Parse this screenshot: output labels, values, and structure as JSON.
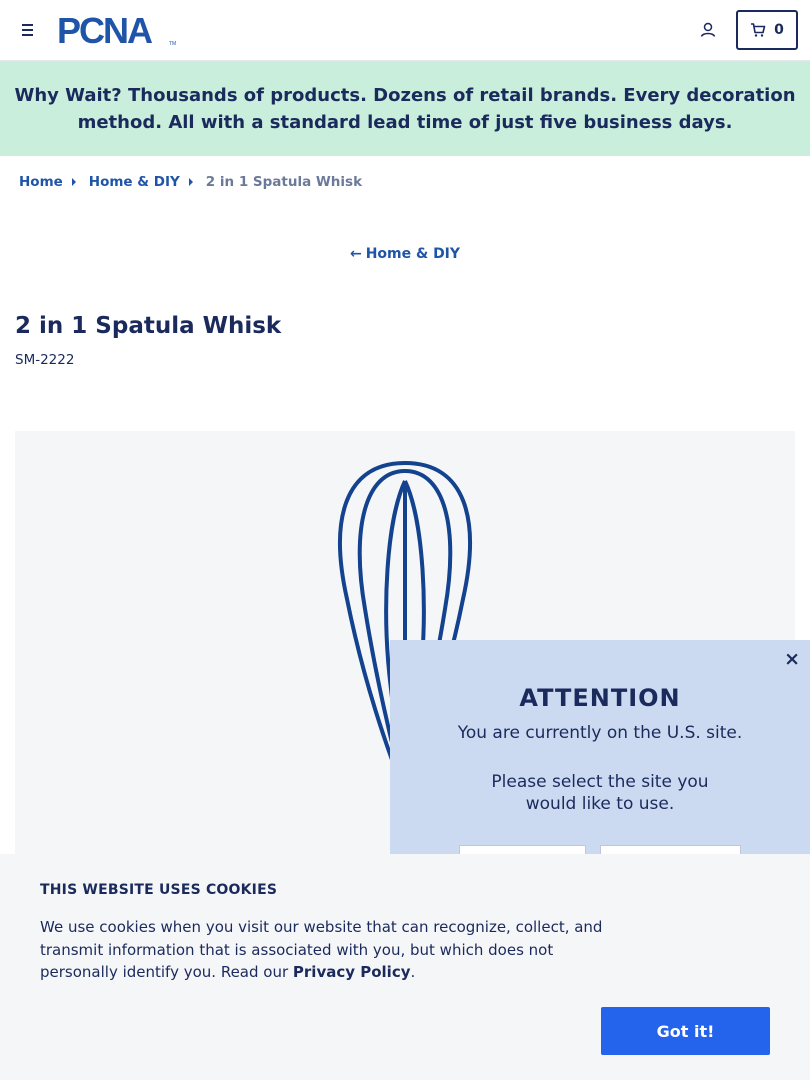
{
  "header": {
    "logo_text": "PCNA",
    "logo_trademark": "TM",
    "cart_count": "0",
    "icons": {
      "menu": "hamburger-menu-icon",
      "account": "user-account-icon",
      "cart": "shopping-cart-icon"
    }
  },
  "promo": {
    "lead": "Why Wait?",
    "text": " Thousands of products. Dozens of retail brands. Every decoration method. All with a standard lead time of just five business days."
  },
  "breadcrumb": {
    "items": [
      "Home",
      "Home & DIY"
    ],
    "current": "2 in 1 Spatula Whisk"
  },
  "back_link": {
    "arrow": "←",
    "label": "Home & DIY"
  },
  "product": {
    "title": "2 in 1 Spatula Whisk",
    "sku": "SM-2222"
  },
  "region_modal": {
    "close": "×",
    "title": "ATTENTION",
    "message": "You are currently on the U.S. site.",
    "prompt": "Please select the site you would like to use."
  },
  "cookie_banner": {
    "title": "THIS WEBSITE USES COOKIES",
    "text": "We use cookies when you visit our website that can recognize, collect, and transmit information that is associated with you, but which does not personally identify you. Read our ",
    "link": "Privacy Policy",
    "text_end": ".",
    "button": "Got it!"
  },
  "colors": {
    "navy": "#1b2a5c",
    "link_blue": "#1f55a8",
    "promo_bg": "#c9eedb",
    "modal_bg": "#cbdaf0",
    "button_blue": "#2463eb",
    "whisk_blue": "#13428f"
  }
}
